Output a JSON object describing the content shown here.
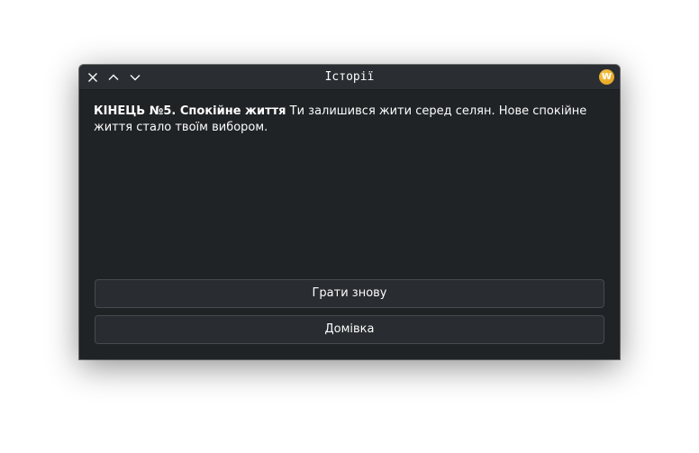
{
  "window": {
    "title": "Історії",
    "icons": {
      "close": "close-icon",
      "up": "chevron-up-icon",
      "down": "chevron-down-icon",
      "app": "app-icon-w"
    },
    "app_icon_letter": "W",
    "app_icon_color": "#f0b12e"
  },
  "story": {
    "heading": "КІНЕЦЬ №5. Спокійне життя",
    "text": " Ти залишився жити серед селян. Нове спокійне життя стало твоїм вибором."
  },
  "buttons": {
    "play_again": "Грати знову",
    "home": "Домівка"
  },
  "colors": {
    "background": "#202326",
    "titlebar": "#2a2e32",
    "button": "#292c30",
    "button_border": "#464a4f",
    "text": "#fcfcfc"
  }
}
